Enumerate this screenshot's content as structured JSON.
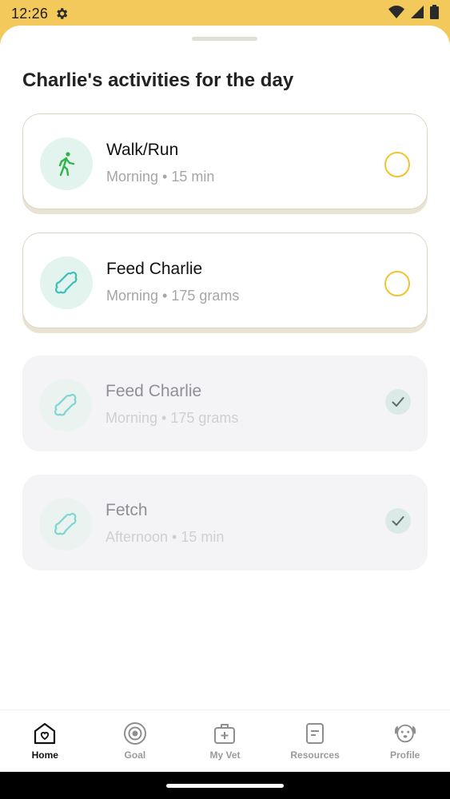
{
  "status_bar": {
    "time": "12:26",
    "icons": [
      "gear-icon",
      "wifi-icon",
      "signal-icon",
      "battery-icon"
    ]
  },
  "sheet": {
    "title": "Charlie's activities for the day"
  },
  "activities": [
    {
      "title": "Walk/Run",
      "subtitle": "Morning • 15 min",
      "icon": "walking-person-icon",
      "completed": false
    },
    {
      "title": "Feed Charlie",
      "subtitle": "Morning • 175 grams",
      "icon": "bone-icon",
      "completed": false
    },
    {
      "title": "Feed Charlie",
      "subtitle": "Morning • 175 grams",
      "icon": "bone-icon",
      "completed": true
    },
    {
      "title": "Fetch",
      "subtitle": "Afternoon • 15 min",
      "icon": "bone-icon",
      "completed": true
    }
  ],
  "nav": {
    "items": [
      {
        "label": "Home",
        "icon": "home-heart-icon",
        "selected": true
      },
      {
        "label": "Goal",
        "icon": "target-icon",
        "selected": false
      },
      {
        "label": "My Vet",
        "icon": "medical-bag-icon",
        "selected": false
      },
      {
        "label": "Resources",
        "icon": "document-icon",
        "selected": false
      },
      {
        "label": "Profile",
        "icon": "dog-face-icon",
        "selected": false
      }
    ]
  },
  "colors": {
    "accent_yellow": "#F2C95A",
    "check_outline": "#F2C230",
    "walk_icon_green": "#2FB34A",
    "bone_icon_teal": "#3CBFB8"
  }
}
